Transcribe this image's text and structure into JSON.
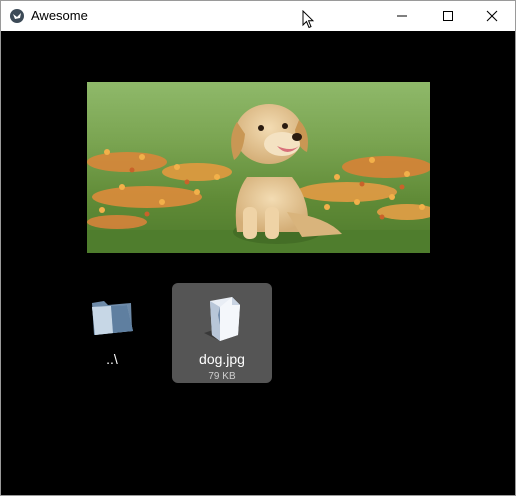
{
  "window": {
    "title": "Awesome",
    "controls": {
      "minimize": "minimize-icon",
      "maximize": "maximize-icon",
      "close": "close-icon"
    }
  },
  "preview": {
    "subject": "puppy photo"
  },
  "files": [
    {
      "name": "..\\",
      "icon": "folder-icon"
    },
    {
      "name": "dog.jpg",
      "size": "79 KB",
      "icon": "image-file-icon",
      "selected": true
    }
  ],
  "colors": {
    "background": "#000000",
    "selected_item": "#555555",
    "titlebar": "#ffffff"
  }
}
